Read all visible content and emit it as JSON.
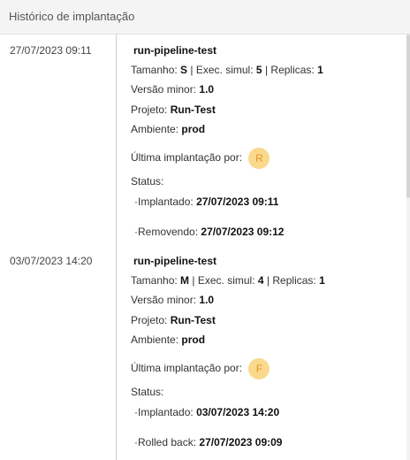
{
  "header": {
    "title": "Histórico de implantação"
  },
  "labels": {
    "size": "Tamanho:",
    "exec": "Exec. simul:",
    "replicas": "Replicas:",
    "sep": "|",
    "minor": "Versão minor:",
    "project": "Projeto:",
    "env": "Ambiente:",
    "last_deploy": "Última implantação por:",
    "status": "Status:",
    "bullet": "·"
  },
  "entries": [
    {
      "date": "27/07/2023 09:11",
      "name": "run-pipeline-test",
      "size": "S",
      "exec": "5",
      "replicas": "1",
      "minor": "1.0",
      "project": "Run-Test",
      "env": "prod",
      "avatar": "R",
      "statuses": [
        {
          "label": "Implantado:",
          "time": "27/07/2023 09:11"
        },
        {
          "label": "Removendo:",
          "time": "27/07/2023 09:12"
        }
      ]
    },
    {
      "date": "03/07/2023 14:20",
      "name": "run-pipeline-test",
      "size": "M",
      "exec": "4",
      "replicas": "1",
      "minor": "1.0",
      "project": "Run-Test",
      "env": "prod",
      "avatar": "F",
      "statuses": [
        {
          "label": "Implantado:",
          "time": "03/07/2023 14:20"
        },
        {
          "label": "Rolled back:",
          "time": "27/07/2023 09:09"
        }
      ]
    }
  ]
}
